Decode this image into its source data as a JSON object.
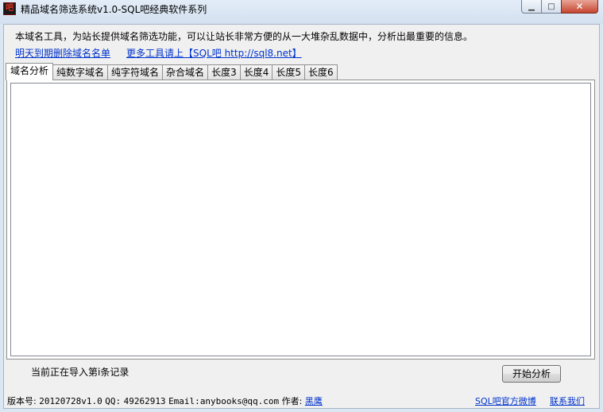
{
  "window": {
    "app_icon_glyph": "吧",
    "title": "精品域名筛选系统v1.0-SQL吧经典软件系列",
    "minimize_glyph": "▁",
    "maximize_glyph": "□",
    "close_glyph": "✕"
  },
  "header": {
    "intro": "本域名工具，为站长提供域名筛选功能，可以让站长非常方便的从一大堆杂乱数据中，分析出最重要的信息。",
    "link_expiring": "明天到期删除域名名单",
    "link_more": "更多工具请上【SQL吧 http://sql8.net】"
  },
  "tabs": [
    {
      "label": "域名分析",
      "active": true
    },
    {
      "label": "纯数字域名",
      "active": false
    },
    {
      "label": "纯字符域名",
      "active": false
    },
    {
      "label": "杂合域名",
      "active": false
    },
    {
      "label": "长度3",
      "active": false
    },
    {
      "label": "长度4",
      "active": false
    },
    {
      "label": "长度5",
      "active": false
    },
    {
      "label": "长度6",
      "active": false
    }
  ],
  "status": {
    "text": "当前正在导入第i条记录"
  },
  "buttons": {
    "start": "开始分析"
  },
  "footer": {
    "version_label": "版本号:",
    "version_value": "20120728v1.0",
    "qq_label": "QQ:",
    "qq_value": "49262913",
    "email_label": "Email:",
    "email_value": "anybooks@qq.com",
    "author_label": "作者:",
    "author_name": "黑鹰",
    "weibo_link": "SQL吧官方微博",
    "contact_link": "联系我们"
  },
  "colors": {
    "link": "#0033cc",
    "frame": "#dbe6f3",
    "client_bg": "#f0f0f0"
  }
}
